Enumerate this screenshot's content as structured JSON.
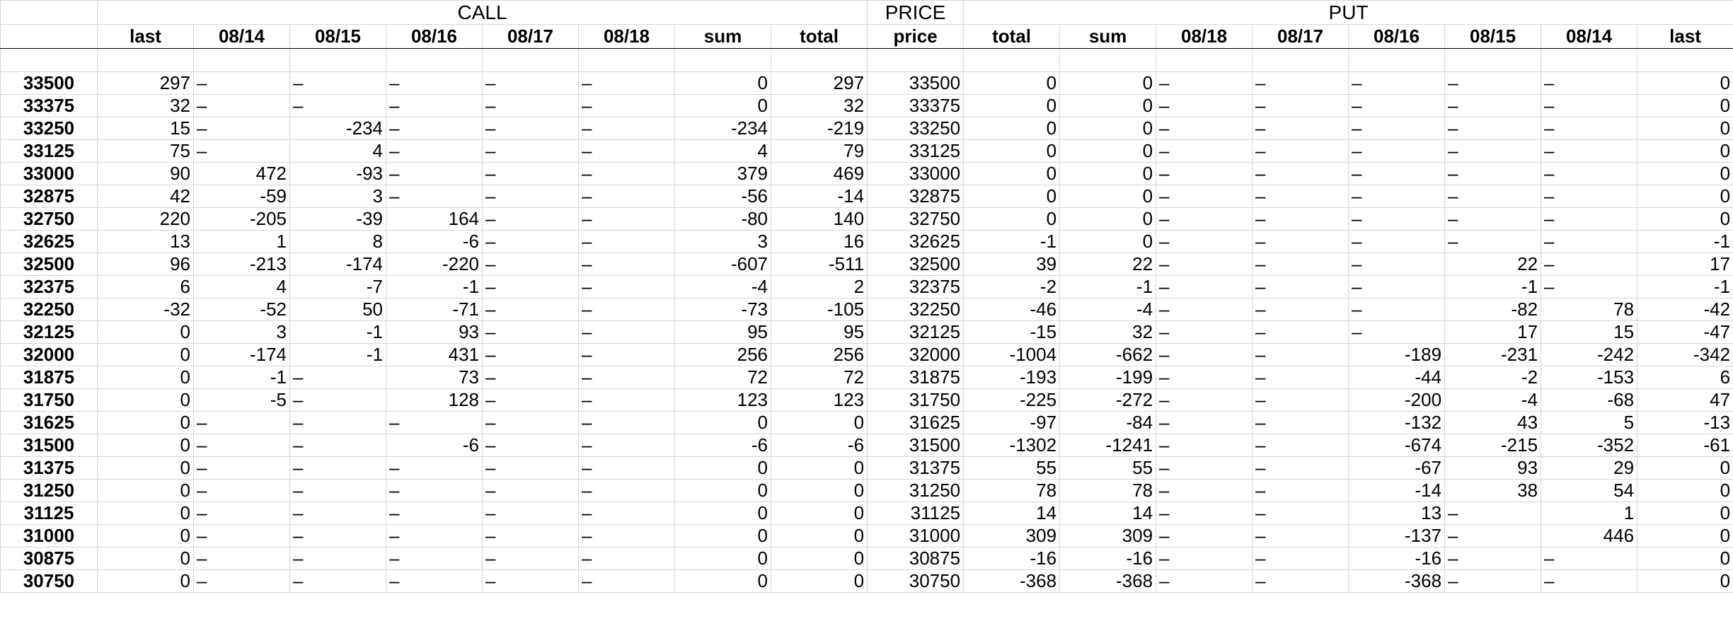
{
  "groups": {
    "call": "CALL",
    "price": "PRICE",
    "put": "PUT"
  },
  "columns": [
    "last",
    "08/14",
    "08/15",
    "08/16",
    "08/17",
    "08/18",
    "sum",
    "total",
    "price",
    "total",
    "sum",
    "08/18",
    "08/17",
    "08/16",
    "08/15",
    "08/14",
    "last"
  ],
  "rows": [
    [
      "33500",
      "297",
      "–",
      "–",
      "–",
      "–",
      "–",
      "0",
      "297",
      "33500",
      "0",
      "0",
      "–",
      "–",
      "–",
      "–",
      "–",
      "0"
    ],
    [
      "33375",
      "32",
      "–",
      "–",
      "–",
      "–",
      "–",
      "0",
      "32",
      "33375",
      "0",
      "0",
      "–",
      "–",
      "–",
      "–",
      "–",
      "0"
    ],
    [
      "33250",
      "15",
      "–",
      "-234",
      "–",
      "–",
      "–",
      "-234",
      "-219",
      "33250",
      "0",
      "0",
      "–",
      "–",
      "–",
      "–",
      "–",
      "0"
    ],
    [
      "33125",
      "75",
      "–",
      "4",
      "–",
      "–",
      "–",
      "4",
      "79",
      "33125",
      "0",
      "0",
      "–",
      "–",
      "–",
      "–",
      "–",
      "0"
    ],
    [
      "33000",
      "90",
      "472",
      "-93",
      "–",
      "–",
      "–",
      "379",
      "469",
      "33000",
      "0",
      "0",
      "–",
      "–",
      "–",
      "–",
      "–",
      "0"
    ],
    [
      "32875",
      "42",
      "-59",
      "3",
      "–",
      "–",
      "–",
      "-56",
      "-14",
      "32875",
      "0",
      "0",
      "–",
      "–",
      "–",
      "–",
      "–",
      "0"
    ],
    [
      "32750",
      "220",
      "-205",
      "-39",
      "164",
      "–",
      "–",
      "-80",
      "140",
      "32750",
      "0",
      "0",
      "–",
      "–",
      "–",
      "–",
      "–",
      "0"
    ],
    [
      "32625",
      "13",
      "1",
      "8",
      "-6",
      "–",
      "–",
      "3",
      "16",
      "32625",
      "-1",
      "0",
      "–",
      "–",
      "–",
      "–",
      "–",
      "-1"
    ],
    [
      "32500",
      "96",
      "-213",
      "-174",
      "-220",
      "–",
      "–",
      "-607",
      "-511",
      "32500",
      "39",
      "22",
      "–",
      "–",
      "–",
      "22",
      "–",
      "17"
    ],
    [
      "32375",
      "6",
      "4",
      "-7",
      "-1",
      "–",
      "–",
      "-4",
      "2",
      "32375",
      "-2",
      "-1",
      "–",
      "–",
      "–",
      "-1",
      "–",
      "-1"
    ],
    [
      "32250",
      "-32",
      "-52",
      "50",
      "-71",
      "–",
      "–",
      "-73",
      "-105",
      "32250",
      "-46",
      "-4",
      "–",
      "–",
      "–",
      "-82",
      "78",
      "-42"
    ],
    [
      "32125",
      "0",
      "3",
      "-1",
      "93",
      "–",
      "–",
      "95",
      "95",
      "32125",
      "-15",
      "32",
      "–",
      "–",
      "–",
      "17",
      "15",
      "-47"
    ],
    [
      "32000",
      "0",
      "-174",
      "-1",
      "431",
      "–",
      "–",
      "256",
      "256",
      "32000",
      "-1004",
      "-662",
      "–",
      "–",
      "-189",
      "-231",
      "-242",
      "-342"
    ],
    [
      "31875",
      "0",
      "-1",
      "–",
      "73",
      "–",
      "–",
      "72",
      "72",
      "31875",
      "-193",
      "-199",
      "–",
      "–",
      "-44",
      "-2",
      "-153",
      "6"
    ],
    [
      "31750",
      "0",
      "-5",
      "–",
      "128",
      "–",
      "–",
      "123",
      "123",
      "31750",
      "-225",
      "-272",
      "–",
      "–",
      "-200",
      "-4",
      "-68",
      "47"
    ],
    [
      "31625",
      "0",
      "–",
      "–",
      "–",
      "–",
      "–",
      "0",
      "0",
      "31625",
      "-97",
      "-84",
      "–",
      "–",
      "-132",
      "43",
      "5",
      "-13"
    ],
    [
      "31500",
      "0",
      "–",
      "–",
      "-6",
      "–",
      "–",
      "-6",
      "-6",
      "31500",
      "-1302",
      "-1241",
      "–",
      "–",
      "-674",
      "-215",
      "-352",
      "-61"
    ],
    [
      "31375",
      "0",
      "–",
      "–",
      "–",
      "–",
      "–",
      "0",
      "0",
      "31375",
      "55",
      "55",
      "–",
      "–",
      "-67",
      "93",
      "29",
      "0"
    ],
    [
      "31250",
      "0",
      "–",
      "–",
      "–",
      "–",
      "–",
      "0",
      "0",
      "31250",
      "78",
      "78",
      "–",
      "–",
      "-14",
      "38",
      "54",
      "0"
    ],
    [
      "31125",
      "0",
      "–",
      "–",
      "–",
      "–",
      "–",
      "0",
      "0",
      "31125",
      "14",
      "14",
      "–",
      "–",
      "13",
      "–",
      "1",
      "0"
    ],
    [
      "31000",
      "0",
      "–",
      "–",
      "–",
      "–",
      "–",
      "0",
      "0",
      "31000",
      "309",
      "309",
      "–",
      "–",
      "-137",
      "–",
      "446",
      "0"
    ],
    [
      "30875",
      "0",
      "–",
      "–",
      "–",
      "–",
      "–",
      "0",
      "0",
      "30875",
      "-16",
      "-16",
      "–",
      "–",
      "-16",
      "–",
      "–",
      "0"
    ],
    [
      "30750",
      "0",
      "–",
      "–",
      "–",
      "–",
      "–",
      "0",
      "0",
      "30750",
      "-368",
      "-368",
      "–",
      "–",
      "-368",
      "–",
      "–",
      "0"
    ]
  ]
}
